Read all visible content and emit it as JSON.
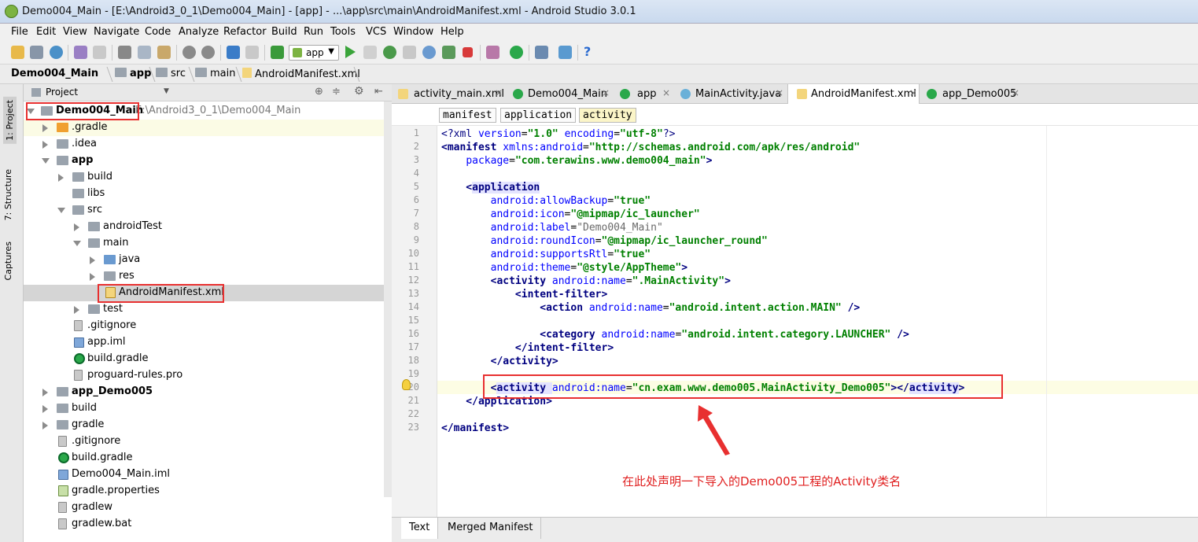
{
  "window": {
    "title": "Demo004_Main - [E:\\Android3_0_1\\Demo004_Main] - [app] - ...\\app\\src\\main\\AndroidManifest.xml - Android Studio 3.0.1"
  },
  "menu": [
    "File",
    "Edit",
    "View",
    "Navigate",
    "Code",
    "Analyze",
    "Refactor",
    "Build",
    "Run",
    "Tools",
    "VCS",
    "Window",
    "Help"
  ],
  "toolbar": {
    "run_config": "app"
  },
  "breadcrumb": [
    "Demo004_Main",
    "app",
    "src",
    "main",
    "AndroidManifest.xml"
  ],
  "side_tabs": {
    "project": "1: Project",
    "structure": "7: Structure",
    "captures": "Captures"
  },
  "project_panel": {
    "title": "Project"
  },
  "tree": [
    {
      "label": "Demo004_Main",
      "path": "E:\\Android3_0_1\\Demo004_Main",
      "bold": true
    },
    {
      "label": ".gradle"
    },
    {
      "label": ".idea"
    },
    {
      "label": "app",
      "bold": true
    },
    {
      "label": "build"
    },
    {
      "label": "libs"
    },
    {
      "label": "src"
    },
    {
      "label": "androidTest"
    },
    {
      "label": "main"
    },
    {
      "label": "java"
    },
    {
      "label": "res"
    },
    {
      "label": "AndroidManifest.xml"
    },
    {
      "label": "test"
    },
    {
      "label": ".gitignore"
    },
    {
      "label": "app.iml"
    },
    {
      "label": "build.gradle"
    },
    {
      "label": "proguard-rules.pro"
    },
    {
      "label": "app_Demo005",
      "bold": true
    },
    {
      "label": "build"
    },
    {
      "label": "gradle"
    },
    {
      "label": ".gitignore"
    },
    {
      "label": "build.gradle"
    },
    {
      "label": "Demo004_Main.iml"
    },
    {
      "label": "gradle.properties"
    },
    {
      "label": "gradlew"
    },
    {
      "label": "gradlew.bat"
    }
  ],
  "tabs": [
    {
      "label": "activity_main.xml"
    },
    {
      "label": "Demo004_Main"
    },
    {
      "label": "app"
    },
    {
      "label": "MainActivity.java"
    },
    {
      "label": "AndroidManifest.xml"
    },
    {
      "label": "app_Demo005"
    }
  ],
  "xml_crumbs": [
    "manifest",
    "application",
    "activity"
  ],
  "code": {
    "l1": {
      "a": "<?xml ",
      "b": "version",
      "c": "=",
      "d": "\"1.0\"",
      "e": " ",
      "f": "encoding",
      "g": "=",
      "h": "\"utf-8\"",
      "i": "?>"
    },
    "l2": {
      "a": "<manifest ",
      "b": "xmlns:android",
      "c": "=",
      "d": "\"http://schemas.android.com/apk/res/android\""
    },
    "l3": {
      "a": "    ",
      "b": "package",
      "c": "=",
      "d": "\"com.terawins.www.demo004_main\"",
      "e": ">"
    },
    "l5": {
      "a": "    <",
      "b": "application"
    },
    "l6": {
      "a": "        ",
      "b": "android:allowBackup",
      "c": "=",
      "d": "\"true\""
    },
    "l7": {
      "a": "        ",
      "b": "android:icon",
      "c": "=",
      "d": "\"@mipmap/ic_launcher\""
    },
    "l8": {
      "a": "        ",
      "b": "android:label",
      "c": "=",
      "d": "\"Demo004_Main\""
    },
    "l9": {
      "a": "        ",
      "b": "android:roundIcon",
      "c": "=",
      "d": "\"@mipmap/ic_launcher_round\""
    },
    "l10": {
      "a": "        ",
      "b": "android:supportsRtl",
      "c": "=",
      "d": "\"true\""
    },
    "l11": {
      "a": "        ",
      "b": "android:theme",
      "c": "=",
      "d": "\"@style/AppTheme\"",
      "e": ">"
    },
    "l12": {
      "a": "        <",
      "b": "activity ",
      "c": "android:name",
      "d": "=",
      "e": "\".MainActivity\"",
      "f": ">"
    },
    "l13": {
      "a": "            <",
      "b": "intent-filter",
      "c": ">"
    },
    "l14": {
      "a": "                <",
      "b": "action ",
      "c": "android:name",
      "d": "=",
      "e": "\"android.intent.action.MAIN\"",
      "f": " />"
    },
    "l16": {
      "a": "                <",
      "b": "category ",
      "c": "android:name",
      "d": "=",
      "e": "\"android.intent.category.LAUNCHER\"",
      "f": " />"
    },
    "l17": {
      "a": "            </",
      "b": "intent-filter",
      "c": ">"
    },
    "l18": {
      "a": "        </",
      "b": "activity",
      "c": ">"
    },
    "l20": {
      "a": "        <",
      "b": "activity ",
      "c": "android:name",
      "d": "=",
      "e": "\"cn.exam.www.demo005.MainActivity_Demo005\"",
      "f": "></",
      "g": "activity",
      "h": ">"
    },
    "l21": {
      "a": "    </",
      "b": "application",
      "c": ">"
    },
    "l23": {
      "a": "</",
      "b": "manifest",
      "c": ">"
    }
  },
  "line_numbers": [
    "1",
    "2",
    "3",
    "4",
    "5",
    "6",
    "7",
    "8",
    "9",
    "10",
    "11",
    "12",
    "13",
    "14",
    "15",
    "16",
    "17",
    "18",
    "19",
    "20",
    "21",
    "22",
    "23"
  ],
  "bottom_tabs": [
    "Text",
    "Merged Manifest"
  ],
  "annotation": "在此处声明一下导入的Demo005工程的Activity类名",
  "colors": {
    "highlight_box": "#e83030",
    "annotation_text": "#e02020"
  }
}
